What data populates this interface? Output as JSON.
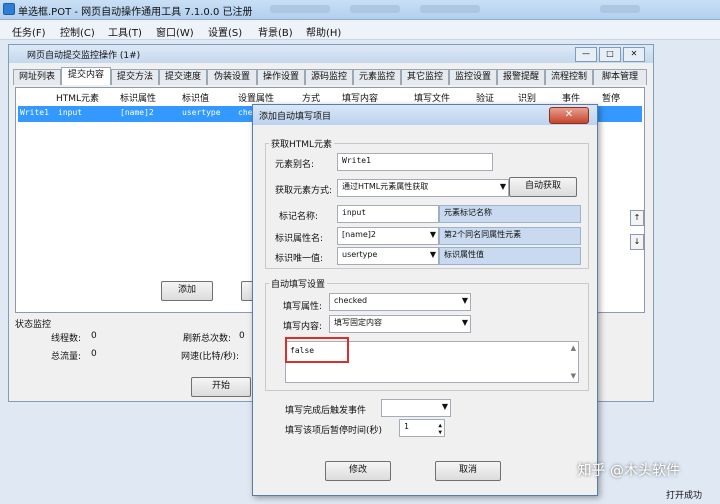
{
  "app": {
    "title": "单选框.POT - 网页自动操作通用工具 7.1.0.0 已注册"
  },
  "menu": [
    "任务(F)",
    "控制(C)",
    "工具(T)",
    "窗口(W)",
    "设置(S)",
    "背景(B)",
    "帮助(H)"
  ],
  "inner": {
    "title": "网页自动提交监控操作 (1#)",
    "tabs": [
      "网址列表",
      "提交内容",
      "提交方法",
      "提交速度",
      "伪装设置",
      "操作设置",
      "源码监控",
      "元素监控",
      "其它监控",
      "监控设置",
      "报警提醒",
      "流程控制",
      "脚本管理"
    ],
    "columns": [
      "HTML元素",
      "标识属性",
      "标识值",
      "设置属性",
      "方式",
      "填写内容",
      "填写文件",
      "验证",
      "识别",
      "事件",
      "暂停"
    ],
    "row": [
      "Write1",
      "input",
      "[name]2",
      "usertype",
      "checked"
    ],
    "add_button": "添加",
    "status": {
      "title": "状态监控",
      "threads_label": "线程数:",
      "threads_value": "0",
      "total_flow_label": "总流量:",
      "total_flow_value": "0",
      "refresh_label": "刷新总次数:",
      "refresh_value": "0",
      "speed_label": "网速(比特/秒):"
    },
    "start_button": "开始"
  },
  "dialog": {
    "title": "添加自动填写项目",
    "get_group": "获取HTML元素",
    "alias_label": "元素别名:",
    "alias_value": "Write1",
    "method_label": "获取元素方式:",
    "method_value": "通过HTML元素属性获取",
    "auto_button": "自动获取",
    "tag_label": "标记名称:",
    "tag_value": "input",
    "tag_hint": "元素标记名称",
    "attr_label": "标识属性名:",
    "attr_value": "[name]2",
    "attr_hint": "第2个同名同属性元素",
    "uniq_label": "标识唯一值:",
    "uniq_value": "usertype",
    "uniq_hint": "标识属性值",
    "fill_group": "自动填写设置",
    "fill_attr_label": "填写属性:",
    "fill_attr_value": "checked",
    "fill_content_label": "填写内容:",
    "fill_content_value": "填写固定内容",
    "text_value": "false",
    "event_label": "填写完成后触发事件",
    "pause_label": "填写该项后暂停时间(秒)",
    "pause_value": "1",
    "modify_button": "修改",
    "cancel_button": "取消"
  },
  "watermark": "知乎 @木头软件",
  "statusbar": "打开成功"
}
